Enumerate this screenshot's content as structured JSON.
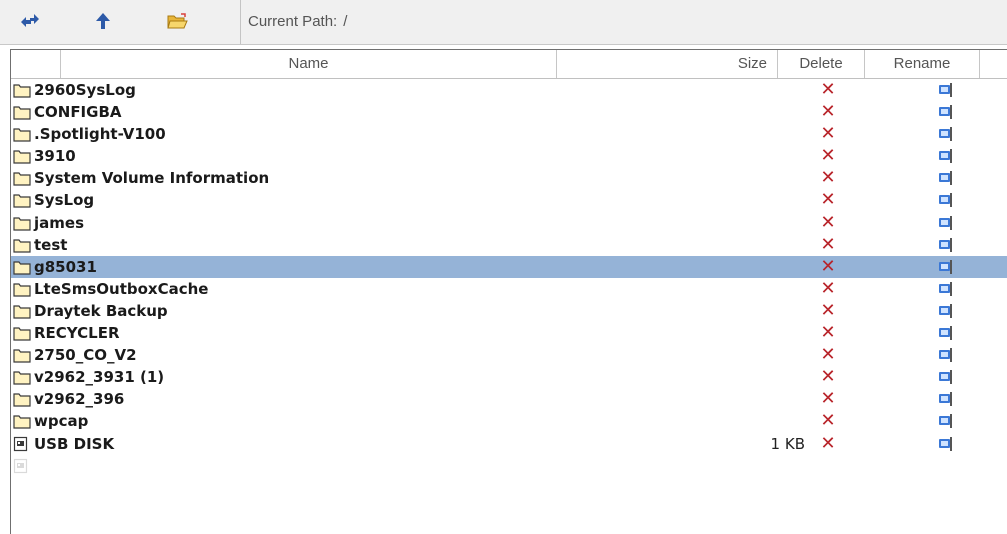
{
  "toolbar": {
    "buttons": [
      {
        "name": "refresh-button",
        "icon": "refresh-arrows-icon"
      },
      {
        "name": "parent-folder-button",
        "icon": "up-arrow-icon"
      },
      {
        "name": "new-folder-button",
        "icon": "folder-open-icon"
      }
    ],
    "path_label": "Current Path:",
    "path_value": "/"
  },
  "table": {
    "headers": {
      "name": "Name",
      "size": "Size",
      "delete": "Delete",
      "rename": "Rename"
    },
    "rows": [
      {
        "name": "2960SysLog",
        "type": "folder",
        "size": ""
      },
      {
        "name": "CONFIGBA",
        "type": "folder",
        "size": ""
      },
      {
        "name": ".Spotlight-V100",
        "type": "folder",
        "size": ""
      },
      {
        "name": "3910",
        "type": "folder",
        "size": ""
      },
      {
        "name": "System Volume Information",
        "type": "folder",
        "size": ""
      },
      {
        "name": "SysLog",
        "type": "folder",
        "size": ""
      },
      {
        "name": "james",
        "type": "folder",
        "size": ""
      },
      {
        "name": "test",
        "type": "folder",
        "size": ""
      },
      {
        "name": "g85031",
        "type": "folder",
        "size": "",
        "selected": true
      },
      {
        "name": "LteSmsOutboxCache",
        "type": "folder",
        "size": ""
      },
      {
        "name": "Draytek Backup",
        "type": "folder",
        "size": ""
      },
      {
        "name": "RECYCLER",
        "type": "folder",
        "size": ""
      },
      {
        "name": "2750_CO_V2",
        "type": "folder",
        "size": ""
      },
      {
        "name": "v2962_3931 (1)",
        "type": "folder",
        "size": ""
      },
      {
        "name": "v2962_396",
        "type": "folder",
        "size": ""
      },
      {
        "name": "wpcap",
        "type": "folder",
        "size": ""
      },
      {
        "name": "USB DISK",
        "type": "file",
        "size": "1 KB"
      }
    ],
    "delete_glyph": "✕",
    "colors": {
      "selected_row": "#95b3d7",
      "delete_x": "#b8242a"
    }
  }
}
